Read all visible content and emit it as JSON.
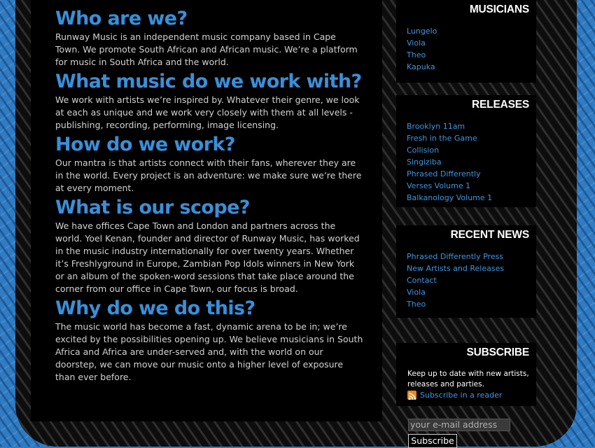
{
  "main": {
    "sections": [
      {
        "heading": "Who are we?",
        "body": "Runway Music is an independent music company based in Cape Town. We promote South African and African music. We’re a platform for music in South Africa and the world."
      },
      {
        "heading": "What music do we work with?",
        "body": "We work with artists we’re inspired by. Whatever their genre, we look at each as unique and we work very closely with them at all levels - publishing, recording, performing, image licensing."
      },
      {
        "heading": "How do we work?",
        "body": "Our mantra is that artists connect with their fans, wherever they are in the world. Every project is an adventure: we make sure we’re there at every moment."
      },
      {
        "heading": "What is our scope?",
        "body": "We have offices Cape Town and London and partners across the world. Yoel Kenan, founder and director of Runway Music, has worked in the music industry internationally for over twenty years. Whether it’s Freshlyground in Europe, Zambian Pop Idols winners in New York or an album of the spoken-word sessions that take place around the corner from our office in Cape Town, our focus is broad."
      },
      {
        "heading": "Why do we do this?",
        "body": "The music world has become a fast, dynamic arena to be in; we’re excited by the possibilities opening up. We believe musicians in South Africa and Africa are under-served and, with the world on our doorstep, we can move our music onto a higher level of exposure than ever before."
      }
    ]
  },
  "sidebar": {
    "musicians": {
      "title": "MUSICIANS",
      "items": [
        "Lungelo",
        "Viola",
        "Theo",
        "Kapuka"
      ]
    },
    "releases": {
      "title": "RELEASES",
      "items": [
        "Brooklyn 11am",
        "Fresh in the Game",
        "Collision",
        "Singiziba",
        "Phrased Differently",
        "Verses Volume 1",
        "Balkanology Volume 1"
      ]
    },
    "news": {
      "title": "RECENT NEWS",
      "items": [
        "Phrased Differently Press",
        "New Artists and Releases",
        "Contact",
        "Viola",
        "Theo"
      ]
    },
    "subscribe": {
      "title": "SUBSCRIBE",
      "text": "Keep up to date with new artists, releases and parties.",
      "reader_link": "Subscribe in a reader",
      "email_placeholder": "your e-mail address",
      "button_label": "Subscribe"
    }
  },
  "colors": {
    "accent": "#3a8fd8",
    "link": "#4196e0",
    "background": "#2f7cc4"
  },
  "icons": {
    "rss": "rss-feed-icon"
  }
}
